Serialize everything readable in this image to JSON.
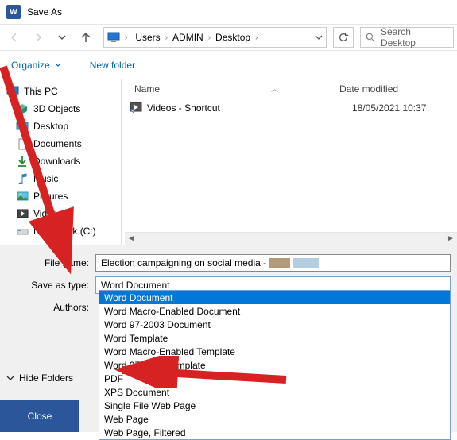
{
  "window": {
    "title": "Save As"
  },
  "nav": {
    "breadcrumb": [
      "Users",
      "ADMIN",
      "Desktop"
    ],
    "search_placeholder": "Search Desktop"
  },
  "toolbar": {
    "organize": "Organize",
    "new_folder": "New folder"
  },
  "tree": {
    "root": "This PC",
    "items": [
      "3D Objects",
      "Desktop",
      "Documents",
      "Downloads",
      "Music",
      "Pictures",
      "Videos",
      "Local Disk (C:)"
    ]
  },
  "fileview": {
    "col_name": "Name",
    "col_date": "Date modified",
    "rows": [
      {
        "name": "Videos - Shortcut",
        "date": "18/05/2021 10:37"
      }
    ]
  },
  "form": {
    "filename_label": "File name:",
    "filename_value": "Election campaigning on social media -",
    "type_label": "Save as type:",
    "type_value": "Word Document",
    "authors_label": "Authors:"
  },
  "dropdown": {
    "options": [
      "Word Document",
      "Word Macro-Enabled Document",
      "Word 97-2003 Document",
      "Word Template",
      "Word Macro-Enabled Template",
      "Word 97-2003 Template",
      "PDF",
      "XPS Document",
      "Single File Web Page",
      "Web Page",
      "Web Page, Filtered"
    ],
    "selected_index": 0
  },
  "footer": {
    "hide_folders": "Hide Folders",
    "close": "Close"
  }
}
